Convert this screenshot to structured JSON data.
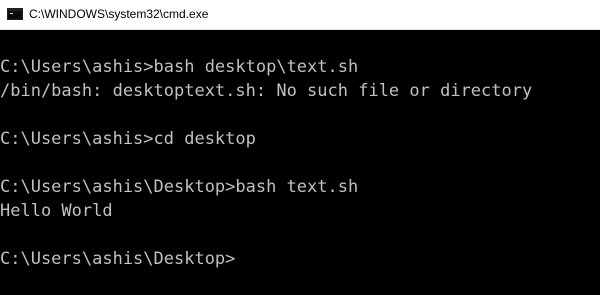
{
  "window": {
    "title": "C:\\WINDOWS\\system32\\cmd.exe",
    "icon": "cmd-icon"
  },
  "console": {
    "colors": {
      "background": "#000000",
      "text": "#c0c0c0"
    },
    "lines": [
      "C:\\Users\\ashis>bash desktop\\text.sh",
      "/bin/bash: desktoptext.sh: No such file or directory",
      "C:\\Users\\ashis>cd desktop",
      "C:\\Users\\ashis\\Desktop>bash text.sh",
      "Hello World",
      "C:\\Users\\ashis\\Desktop>"
    ]
  }
}
